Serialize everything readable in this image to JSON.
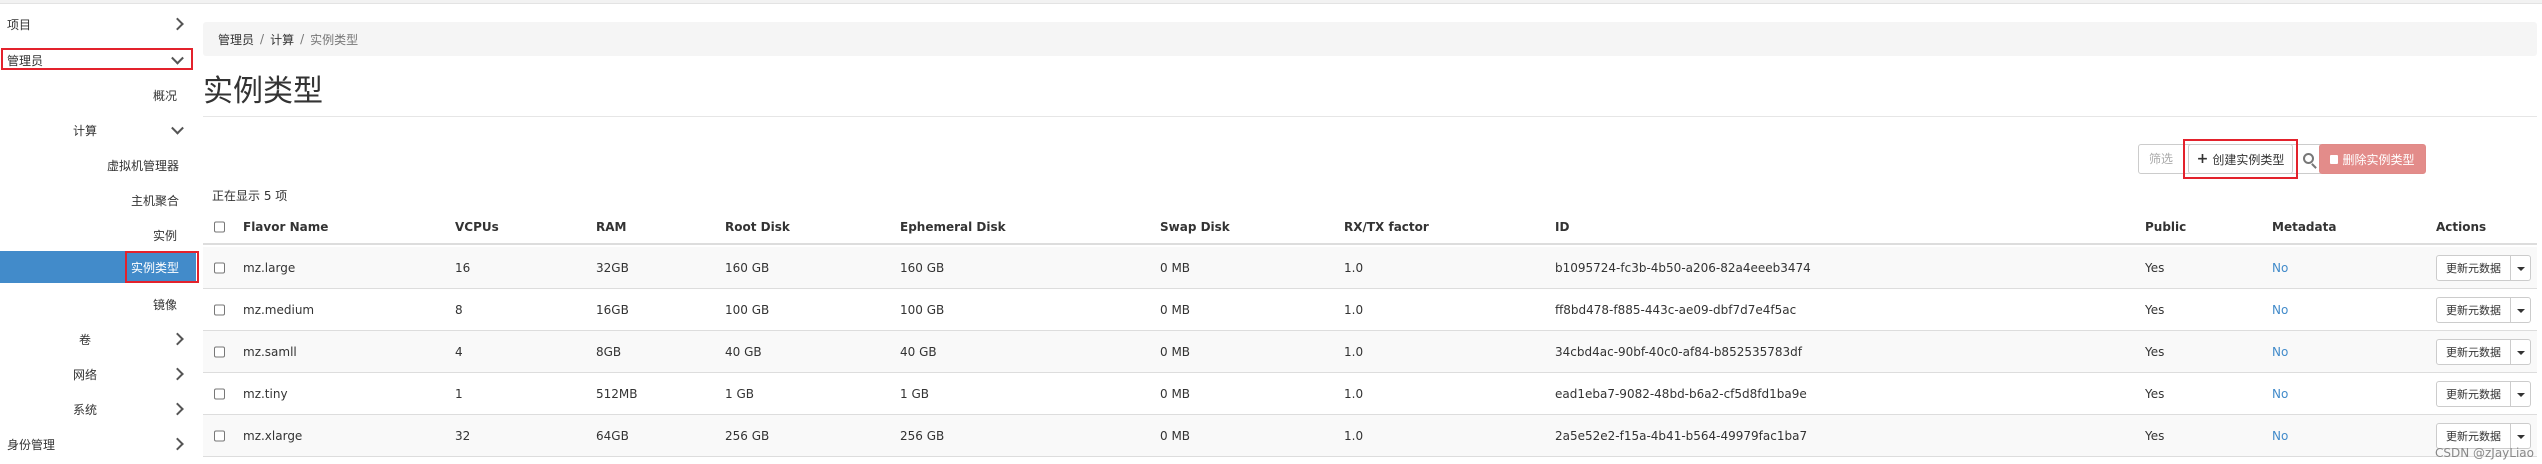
{
  "sidebar": {
    "items": [
      {
        "label": "项目"
      },
      {
        "label": "管理员"
      },
      {
        "label": "概况"
      },
      {
        "label": "计算"
      },
      {
        "label": "虚拟机管理器"
      },
      {
        "label": "主机聚合"
      },
      {
        "label": "实例"
      },
      {
        "label": "实例类型"
      },
      {
        "label": "镜像"
      },
      {
        "label": "卷"
      },
      {
        "label": "网络"
      },
      {
        "label": "系统"
      },
      {
        "label": "身份管理"
      }
    ]
  },
  "breadcrumb": {
    "items": [
      "管理员",
      "计算",
      "实例类型"
    ]
  },
  "page": {
    "title": "实例类型",
    "showing": "正在显示 5 项"
  },
  "toolbar": {
    "filter_placeholder": "筛选",
    "create_label": "创建实例类型",
    "delete_label": "删除实例类型",
    "create_icon": "plus-icon",
    "delete_icon": "trash-icon",
    "delete_color": "#e38c8a"
  },
  "table": {
    "columns": [
      "Flavor Name",
      "VCPUs",
      "RAM",
      "Root Disk",
      "Ephemeral Disk",
      "Swap Disk",
      "RX/TX factor",
      "ID",
      "Public",
      "Metadata",
      "Actions"
    ],
    "rows": [
      {
        "name": "mz.large",
        "vcpus": "16",
        "ram": "32GB",
        "root": "160 GB",
        "eph": "160 GB",
        "swap": "0 MB",
        "rxtx": "1.0",
        "id": "b1095724-fc3b-4b50-a206-82a4eeeb3474",
        "public": "Yes",
        "metadata": "No",
        "action": "更新元数据"
      },
      {
        "name": "mz.medium",
        "vcpus": "8",
        "ram": "16GB",
        "root": "100 GB",
        "eph": "100 GB",
        "swap": "0 MB",
        "rxtx": "1.0",
        "id": "ff8bd478-f885-443c-ae09-dbf7d7e4f5ac",
        "public": "Yes",
        "metadata": "No",
        "action": "更新元数据"
      },
      {
        "name": "mz.samll",
        "vcpus": "4",
        "ram": "8GB",
        "root": "40 GB",
        "eph": "40 GB",
        "swap": "0 MB",
        "rxtx": "1.0",
        "id": "34cbd4ac-90bf-40c0-af84-b852535783df",
        "public": "Yes",
        "metadata": "No",
        "action": "更新元数据"
      },
      {
        "name": "mz.tiny",
        "vcpus": "1",
        "ram": "512MB",
        "root": "1 GB",
        "eph": "1 GB",
        "swap": "0 MB",
        "rxtx": "1.0",
        "id": "ead1eba7-9082-48bd-b6a2-cf5d8fd1ba9e",
        "public": "Yes",
        "metadata": "No",
        "action": "更新元数据"
      },
      {
        "name": "mz.xlarge",
        "vcpus": "32",
        "ram": "64GB",
        "root": "256 GB",
        "eph": "256 GB",
        "swap": "0 MB",
        "rxtx": "1.0",
        "id": "2a5e52e2-f15a-4b41-b564-49979fac1ba7",
        "public": "Yes",
        "metadata": "No",
        "action": "更新元数据"
      }
    ]
  },
  "watermark": "CSDN @zJayLiao",
  "colors": {
    "active_nav": "#428bca",
    "link": "#428bca",
    "highlight_box": "#e3222c"
  }
}
